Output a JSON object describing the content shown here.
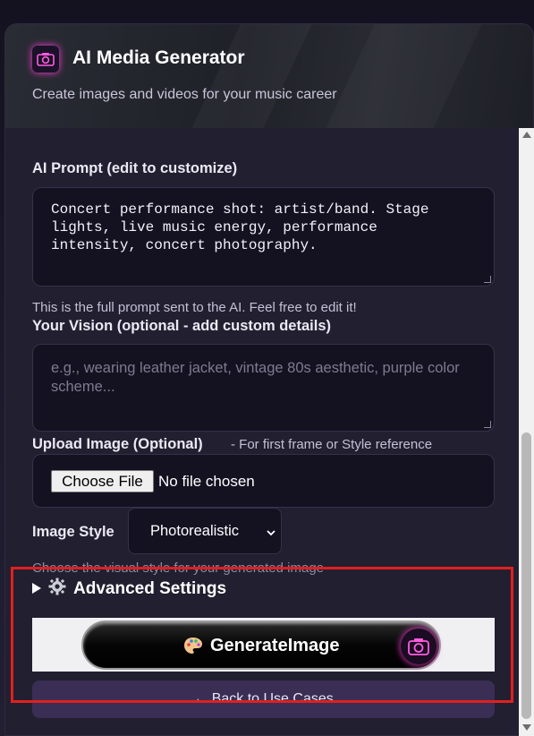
{
  "header": {
    "title": "AI Media Generator",
    "subtitle": "Create images and videos for your music career",
    "logo_icon": "camera-icon"
  },
  "prompt": {
    "label": "AI Prompt (edit to customize)",
    "value": "Concert performance shot: artist/band. Stage\nlights, live music energy, performance\nintensity, concert photography.",
    "hint": "This is the full prompt sent to the AI. Feel free to edit it!"
  },
  "vision": {
    "label": "Your Vision (optional - add custom details)",
    "placeholder": "e.g., wearing leather jacket, vintage 80s aesthetic, purple color scheme..."
  },
  "upload": {
    "label": "Upload Image (Optional)",
    "note": "- For first frame or Style reference",
    "button_label": "Choose File",
    "status": "No file chosen"
  },
  "style": {
    "label": "Image Style",
    "selected": "Photorealistic",
    "hint": "Choose the visual style for your generated image"
  },
  "advanced": {
    "label": "Advanced Settings",
    "icon": "gear-icon"
  },
  "generate": {
    "label": "GenerateImage",
    "icon": "palette-icon"
  },
  "back": {
    "label": "← Back to Use Cases"
  },
  "colors": {
    "accent": "#ff3fd8",
    "panel": "#221f30",
    "highlight": "#e02020"
  }
}
